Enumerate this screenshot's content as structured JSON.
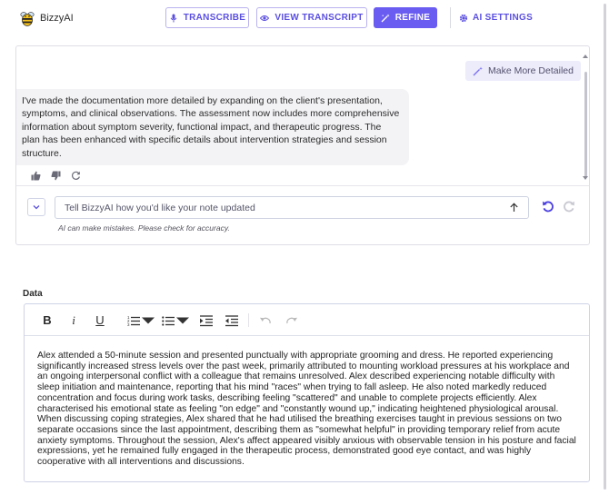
{
  "app": {
    "name": "BizzyAI"
  },
  "toolbar": {
    "transcribe_label": "TRANSCRIBE",
    "view_transcript_label": "VIEW TRANSCRIPT",
    "refine_label": "REFINE",
    "ai_settings_label": "AI SETTINGS",
    "accent_color": "#6a5cf0"
  },
  "chat": {
    "user_message": "Make More Detailed",
    "ai_message": "I've made the documentation more detailed by expanding on the client's presentation, symptoms, and clinical observations. The assessment now includes more comprehensive information about symptom severity, functional impact, and therapeutic progress. The plan has been enhanced with specific details about intervention strategies and session structure.",
    "input_placeholder": "Tell BizzyAI how you'd like your note updated",
    "disclaimer": "AI can make mistakes. Please check for accuracy."
  },
  "data_section": {
    "label": "Data",
    "body": "Alex attended a 50-minute session and presented punctually with appropriate grooming and dress. He reported experiencing significantly increased stress levels over the past week, primarily attributed to mounting workload pressures at his workplace and an ongoing interpersonal conflict with a colleague that remains unresolved. Alex described experiencing notable difficulty with sleep initiation and maintenance, reporting that his mind \"races\" when trying to fall asleep. He also noted markedly reduced concentration and focus during work tasks, describing feeling \"scattered\" and unable to complete projects efficiently. Alex characterised his emotional state as feeling \"on edge\" and \"constantly wound up,\" indicating heightened physiological arousal. When discussing coping strategies, Alex shared that he had utilised the breathing exercises taught in previous sessions on two separate occasions since the last appointment, describing them as \"somewhat helpful\" in providing temporary relief from acute anxiety symptoms. Throughout the session, Alex's affect appeared visibly anxious with observable tension in his posture and facial expressions, yet he remained fully engaged in the therapeutic process, demonstrated good eye contact, and was highly cooperative with all interventions and discussions."
  },
  "editor_toolbar": {
    "bold": "B",
    "italic": "i",
    "underline": "U"
  }
}
